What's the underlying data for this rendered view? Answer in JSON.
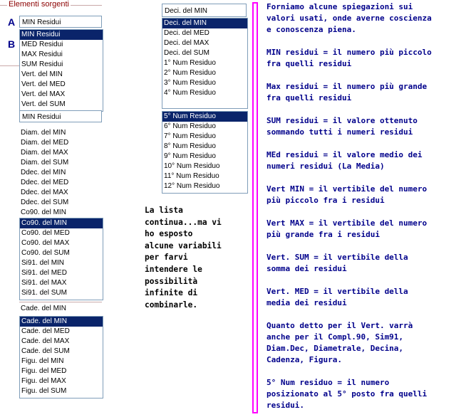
{
  "group": {
    "title": "Elementi sorgenti",
    "label_a": "A",
    "label_b": "B",
    "combo_a": "MIN Residui",
    "combo_b": "MIN Residui",
    "list1": [
      "MIN Residui",
      "MED Residui",
      "MAX Residui",
      "SUM Residui",
      "Vert. del MIN",
      "Vert. del MED",
      "Vert. del MAX",
      "Vert. del SUM"
    ]
  },
  "list_left": [
    "Diam. del MIN",
    "Diam. del MED",
    "Diam. del MAX",
    "Diam. del SUM",
    "Ddec. del MIN",
    "Ddec. del MED",
    "Ddec. del MAX",
    "Ddec. del SUM",
    "Co90. del MIN"
  ],
  "list_co": [
    "Co90. del MIN",
    "Co90. del MED",
    "Co90. del MAX",
    "Co90. del SUM",
    "Si91. del MIN",
    "Si91. del MED",
    "Si91. del MAX",
    "Si91. del SUM"
  ],
  "combo_cade": "Cade. del MIN",
  "list_cade": [
    "Cade. del MIN",
    "Cade. del MED",
    "Cade. del MAX",
    "Cade. del SUM",
    "Figu. del MIN",
    "Figu. del MED",
    "Figu. del MAX",
    "Figu. del SUM"
  ],
  "deci_combo": "Deci. del MIN",
  "list_deci": [
    "Deci. del MIN",
    "Deci. del MED",
    "Deci. del MAX",
    "Deci. del SUM",
    "1° Num Residuo",
    "2° Num Residuo",
    "3° Num Residuo",
    "4° Num Residuo"
  ],
  "deci_combo2": "5° Num Residuo",
  "list_num": [
    "5° Num Residuo",
    "6° Num Residuo",
    "7° Num Residuo",
    "8° Num Residuo",
    "9° Num Residuo",
    "10° Num Residuo",
    "11° Num Residuo",
    "12° Num Residuo"
  ],
  "middle_note": "La lista\ncontinua...ma vi\nho esposto\nalcune variabili\nper farvi\nintendere le\npossibilità\ninfinite di\ncombinarle.",
  "notes": "Forniamo alcune spiegazioni sui\nvalori usati, onde averne coscienza\ne conoscenza piena.\n\nMIN residui = il numero più piccolo\nfra quelli residui\n\nMax residui = il numero più grande\nfra quelli residui\n\nSUM residui = il valore ottenuto\nsommando tutti i numeri residui\n\nMEd residui = il valore medio dei\nnumeri residui (La Media)\n\nVert MIN = il vertibile del numero\npiù piccolo fra i residui\n\nVert MAX = il vertibile del numero\npiù grande fra i residui\n\nVert. SUM = il vertibile della\nsomma dei residui\n\nVert. MED = il vertibile della\nmedia dei residui\n\nQuanto detto per il Vert. varrà\nanche per il Compl.90, Sim91,\nDiam.Dec, Diametrale, Decina,\nCadenza, Figura.\n\n5° Num residuo = il numero\nposizionato al 5° posto fra quelli\nresidui.",
  "colors": {
    "selection": "#0a246a",
    "notes_border": "#ff00ff",
    "note_text_blue": "#00008b",
    "group_title": "#8b0000"
  }
}
